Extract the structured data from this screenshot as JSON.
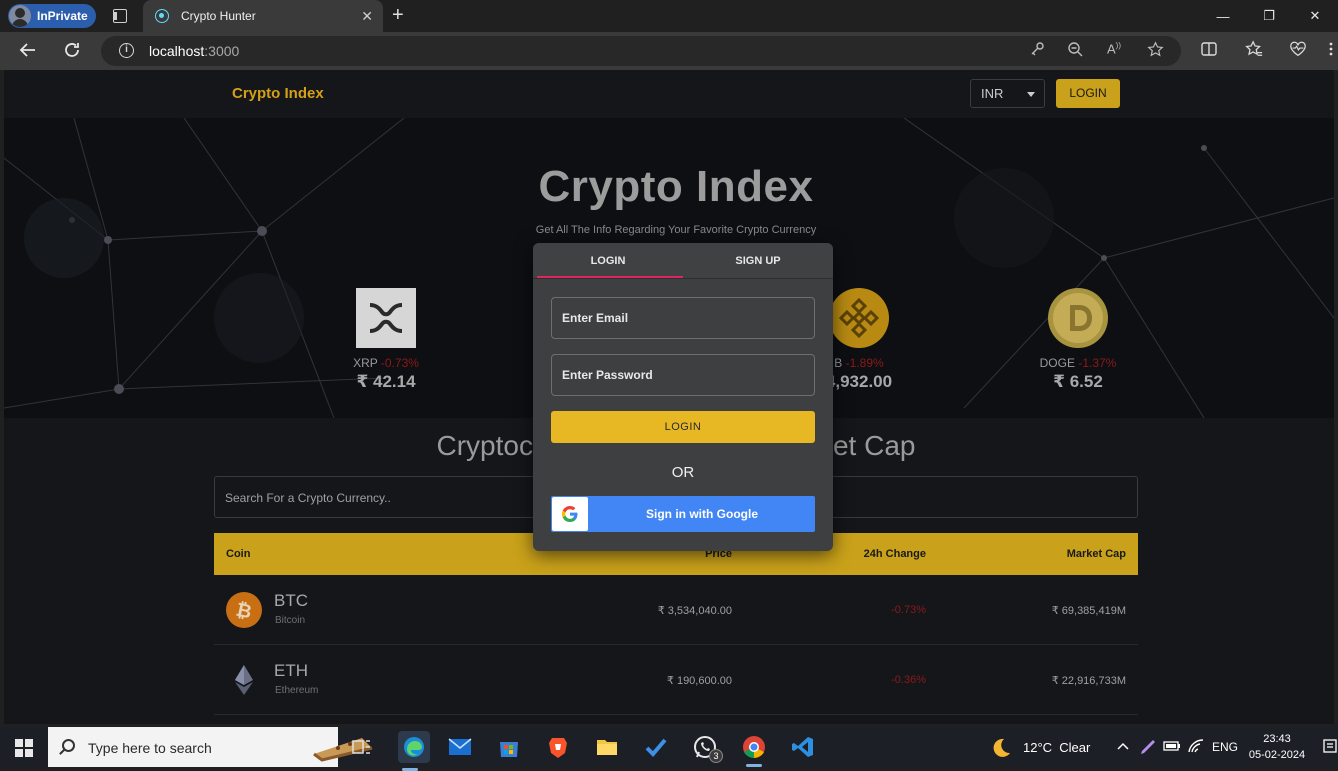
{
  "browser": {
    "profile_label": "InPrivate",
    "tab_title": "Crypto Hunter",
    "tab_close": "✕",
    "new_tab": "+",
    "url_host": "localhost",
    "url_port": ":3000",
    "window_controls": [
      "—",
      "❐",
      "✕"
    ]
  },
  "header": {
    "brand": "Crypto Index",
    "currency": "INR",
    "login_label": "LOGIN"
  },
  "banner": {
    "title": "Crypto Index",
    "subtitle": "Get All The Info Regarding Your Favorite Crypto Currency",
    "coins": [
      {
        "symbol": "XRP",
        "change": "-0.73%",
        "price": "₹ 42.14"
      },
      {
        "symbol": "B",
        "change": "-1.89%",
        "price": "4,932.00"
      },
      {
        "symbol": "DOGE",
        "change": "-1.37%",
        "price": "₹ 6.52"
      }
    ]
  },
  "section": {
    "title": "Cryptoc",
    "title_tail": "et Cap",
    "search_placeholder": "Search For a Crypto Currency.."
  },
  "table": {
    "headers": {
      "coin": "Coin",
      "price": "Price",
      "change": "24h Change",
      "market_cap": "Market Cap"
    },
    "rows": [
      {
        "symbol": "BTC",
        "name": "Bitcoin",
        "price": "₹ 3,534,040.00",
        "change": "-0.73%",
        "market_cap": "₹ 69,385,419M"
      },
      {
        "symbol": "ETH",
        "name": "Ethereum",
        "price": "₹ 190,600.00",
        "change": "-0.36%",
        "market_cap": "₹ 22,916,733M"
      }
    ]
  },
  "modal": {
    "tabs": [
      "LOGIN",
      "SIGN UP"
    ],
    "email_placeholder": "Enter Email",
    "password_placeholder": "Enter Password",
    "login_button": "LOGIN",
    "or_text": "OR",
    "google_button": "Sign in with Google"
  },
  "taskbar": {
    "search_placeholder": "Type here to search",
    "whatsapp_badge": "3",
    "weather": "12°C  Clear",
    "language": "ENG",
    "time": "23:43",
    "date": "05-02-2024"
  },
  "colors": {
    "accent_gold": "#c9a11a",
    "button_yellow": "#e8b824",
    "tab_indicator": "#e0245e",
    "google_blue": "#4285f4",
    "negative_change": "#8c1a1a"
  }
}
